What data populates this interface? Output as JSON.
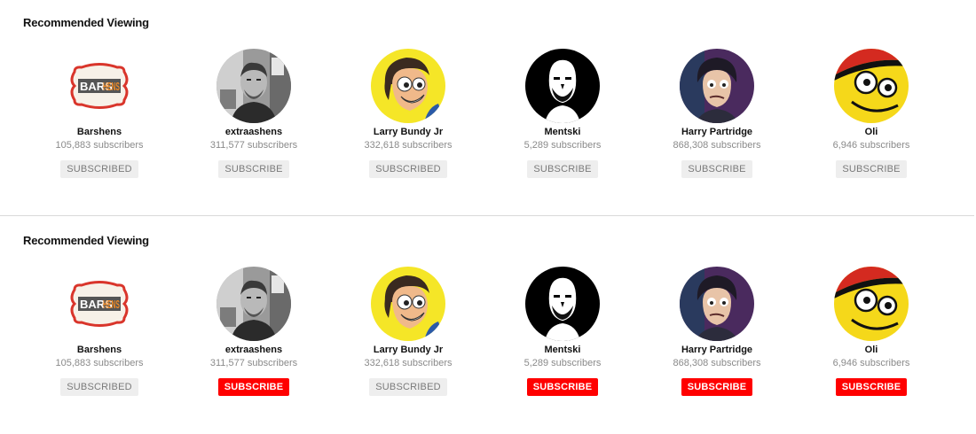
{
  "sections": [
    {
      "title": "Recommended Viewing",
      "channels": [
        {
          "name": "Barshens",
          "subscribers": "105,883 subscribers",
          "button": "SUBSCRIBED",
          "state": "subscribed",
          "avatar": "barshens-logo"
        },
        {
          "name": "extraashens",
          "subscribers": "311,577 subscribers",
          "button": "SUBSCRIBE",
          "state": "gray",
          "avatar": "man-photo-bw"
        },
        {
          "name": "Larry Bundy Jr",
          "subscribers": "332,618 subscribers",
          "button": "SUBSCRIBED",
          "state": "subscribed",
          "avatar": "cartoon-man-yellow"
        },
        {
          "name": "Mentski",
          "subscribers": "5,289 subscribers",
          "button": "SUBSCRIBE",
          "state": "gray",
          "avatar": "bald-man-black"
        },
        {
          "name": "Harry Partridge",
          "subscribers": "868,308 subscribers",
          "button": "SUBSCRIBE",
          "state": "gray",
          "avatar": "cartoon-man-purple"
        },
        {
          "name": "Oli",
          "subscribers": "6,946 subscribers",
          "button": "SUBSCRIBE",
          "state": "gray",
          "avatar": "yellow-creature"
        }
      ]
    },
    {
      "title": "Recommended Viewing",
      "channels": [
        {
          "name": "Barshens",
          "subscribers": "105,883 subscribers",
          "button": "SUBSCRIBED",
          "state": "subscribed",
          "avatar": "barshens-logo"
        },
        {
          "name": "extraashens",
          "subscribers": "311,577 subscribers",
          "button": "SUBSCRIBE",
          "state": "red",
          "avatar": "man-photo-bw"
        },
        {
          "name": "Larry Bundy Jr",
          "subscribers": "332,618 subscribers",
          "button": "SUBSCRIBED",
          "state": "subscribed",
          "avatar": "cartoon-man-yellow"
        },
        {
          "name": "Mentski",
          "subscribers": "5,289 subscribers",
          "button": "SUBSCRIBE",
          "state": "red",
          "avatar": "bald-man-black"
        },
        {
          "name": "Harry Partridge",
          "subscribers": "868,308 subscribers",
          "button": "SUBSCRIBE",
          "state": "red",
          "avatar": "cartoon-man-purple"
        },
        {
          "name": "Oli",
          "subscribers": "6,946 subscribers",
          "button": "SUBSCRIBE",
          "state": "red",
          "avatar": "yellow-creature"
        }
      ]
    }
  ],
  "logo_text": {
    "left": "BARS",
    "right": "HENS"
  },
  "colors": {
    "subscribe_red": "#ff0000",
    "subscribed_gray": "#eeeeee",
    "logo_red": "#d9352b",
    "logo_orange": "#f08a24"
  }
}
